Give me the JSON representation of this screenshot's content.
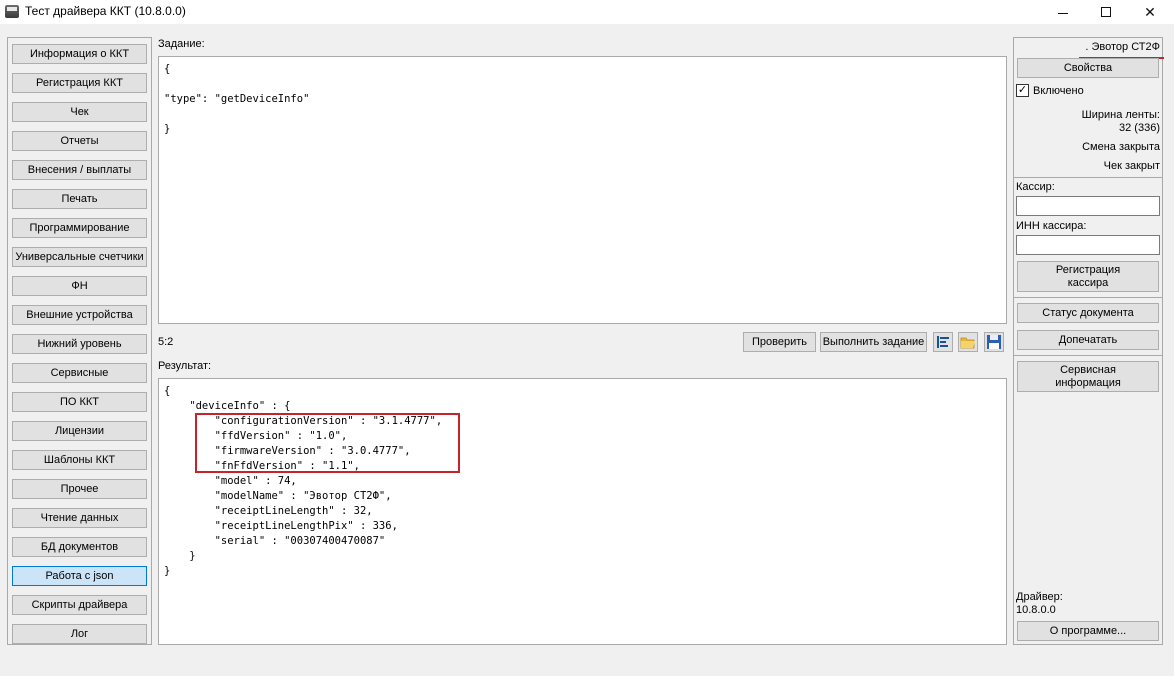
{
  "window": {
    "title": "Тест драйвера ККТ (10.8.0.0)",
    "controls": {
      "minimize": "",
      "maximize": "",
      "close": "✕"
    }
  },
  "sidebar": {
    "items": [
      "Информация о ККТ",
      "Регистрация ККТ",
      "Чек",
      "Отчеты",
      "Внесения / выплаты",
      "Печать",
      "Программирование",
      "Универсальные счетчики",
      "ФН",
      "Внешние устройства",
      "Нижний уровень",
      "Сервисные",
      "ПО ККТ",
      "Лицензии",
      "Шаблоны ККТ",
      "Прочее",
      "Чтение данных",
      "БД документов",
      "Работа с json",
      "Скрипты драйвера",
      "Лог"
    ],
    "active_index": 18
  },
  "task": {
    "label": "Задание:",
    "lines": [
      "{",
      "",
      "\"type\": \"getDeviceInfo\"",
      "",
      "}"
    ]
  },
  "toolbar": {
    "cursor_pos": "5:2",
    "check_label": "Проверить",
    "execute_label": "Выполнить задание",
    "icons": [
      "format-icon",
      "open-folder-icon",
      "save-icon"
    ]
  },
  "result": {
    "label": "Результат:",
    "lines": [
      "{",
      "    \"deviceInfo\" : {",
      "        \"configurationVersion\" : \"3.1.4777\",",
      "        \"ffdVersion\" : \"1.0\",",
      "        \"firmwareVersion\" : \"3.0.4777\",",
      "        \"fnFfdVersion\" : \"1.1\",",
      "        \"model\" : 74,",
      "        \"modelName\" : \"Эвотор СТ2Ф\",",
      "        \"receiptLineLength\" : 32,",
      "        \"receiptLineLengthPix\" : 336,",
      "        \"serial\" : \"00307400470087\"",
      "    }",
      "}"
    ],
    "highlight_color": "#c8232c"
  },
  "right_panel": {
    "device_name": ". Эвотор СТ2Ф",
    "properties_label": "Свойства",
    "enabled_label": "Включено",
    "enabled_checked": "✓",
    "tape_width_label": "Ширина ленты:",
    "tape_width_value": "32 (336)",
    "shift_status": "Смена закрыта",
    "receipt_status": "Чек закрыт",
    "cashier_label": "Кассир:",
    "cashier_value": "",
    "cashier_inn_label": "ИНН кассира:",
    "cashier_inn_value": "",
    "register_cashier_label_1": "Регистрация",
    "register_cashier_label_2": "кассира",
    "doc_status_label": "Статус документа",
    "reprint_label": "Допечатать",
    "service_info_label_1": "Сервисная",
    "service_info_label_2": "информация",
    "driver_label": "Драйвер:",
    "driver_version": "10.8.0.0",
    "about_label": "О программе..."
  }
}
